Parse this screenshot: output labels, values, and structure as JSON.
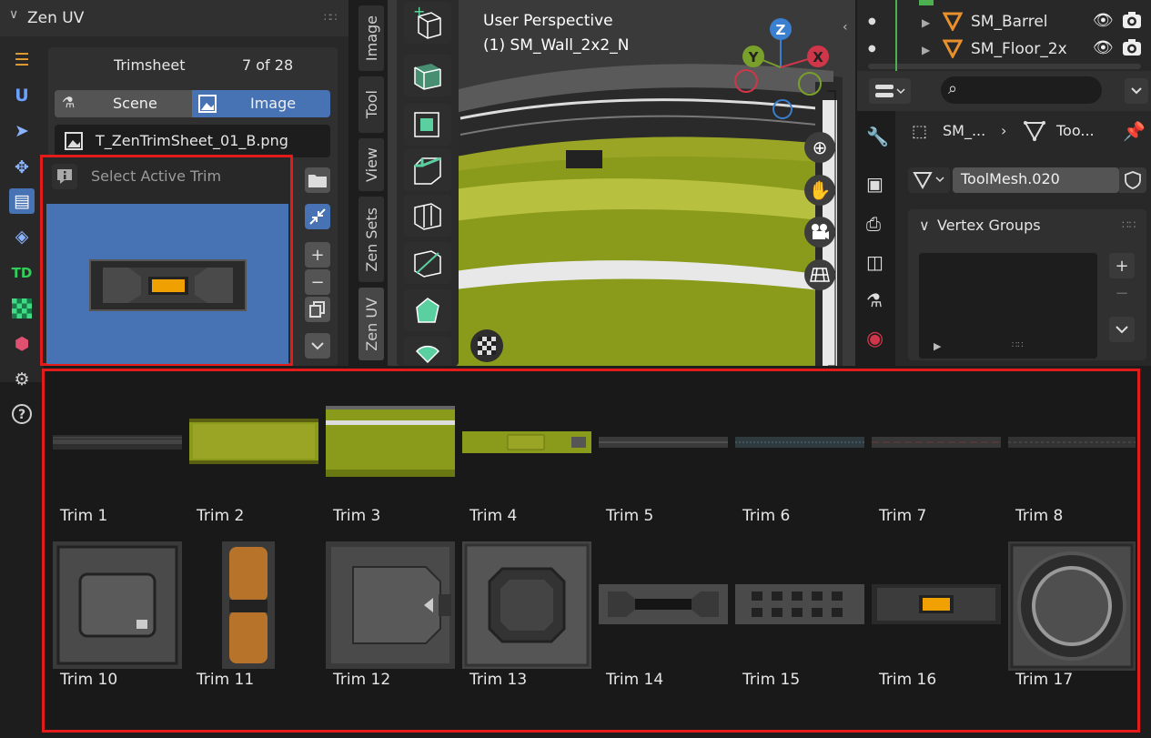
{
  "left_panel": {
    "title": "Zen UV",
    "trimsheet_label": "Trimsheet",
    "trimsheet_count": "7 of 28",
    "scene_tab": "Scene",
    "image_tab": "Image",
    "file_name": "T_ZenTrimSheet_01_B.png",
    "select_trim_label": "Select Active Trim",
    "side_icons": [
      "list-icon",
      "zen-u-icon",
      "cursor-icon",
      "move-icon",
      "trim-panel-icon",
      "layers-icon",
      "td-icon",
      "checker-icon",
      "cube-icon",
      "settings-icon",
      "help-icon"
    ],
    "td_text": "TD",
    "u_text": "U"
  },
  "vertical_tabs": [
    "Image",
    "Tool",
    "View",
    "Zen Sets",
    "Zen UV"
  ],
  "viewport": {
    "title": "User Perspective",
    "subtitle": "(1) SM_Wall_2x2_N",
    "axis_z": "Z",
    "axis_y": "Y",
    "axis_x": "X"
  },
  "outliner": {
    "items": [
      {
        "name": "SM_Barrel"
      },
      {
        "name": "SM_Floor_2x"
      }
    ]
  },
  "properties": {
    "crumb_object": "SM_...",
    "crumb_mesh": "Too...",
    "mesh_name": "ToolMesh.020",
    "vertex_groups_title": "Vertex Groups"
  },
  "trims": {
    "row1": [
      "Trim 1",
      "Trim 2",
      "Trim 3",
      "Trim 4",
      "Trim 5",
      "Trim 6",
      "Trim 7",
      "Trim 8"
    ],
    "row2": [
      "Trim 10",
      "Trim 11",
      "Trim 12",
      "Trim 13",
      "Trim 14",
      "Trim 15",
      "Trim 16",
      "Trim 17"
    ]
  },
  "colors": {
    "accent": "#4772b3",
    "highlight_border": "#e21b1b",
    "trim_olive": "#8a9a1a",
    "trim_orange": "#f0a000"
  }
}
